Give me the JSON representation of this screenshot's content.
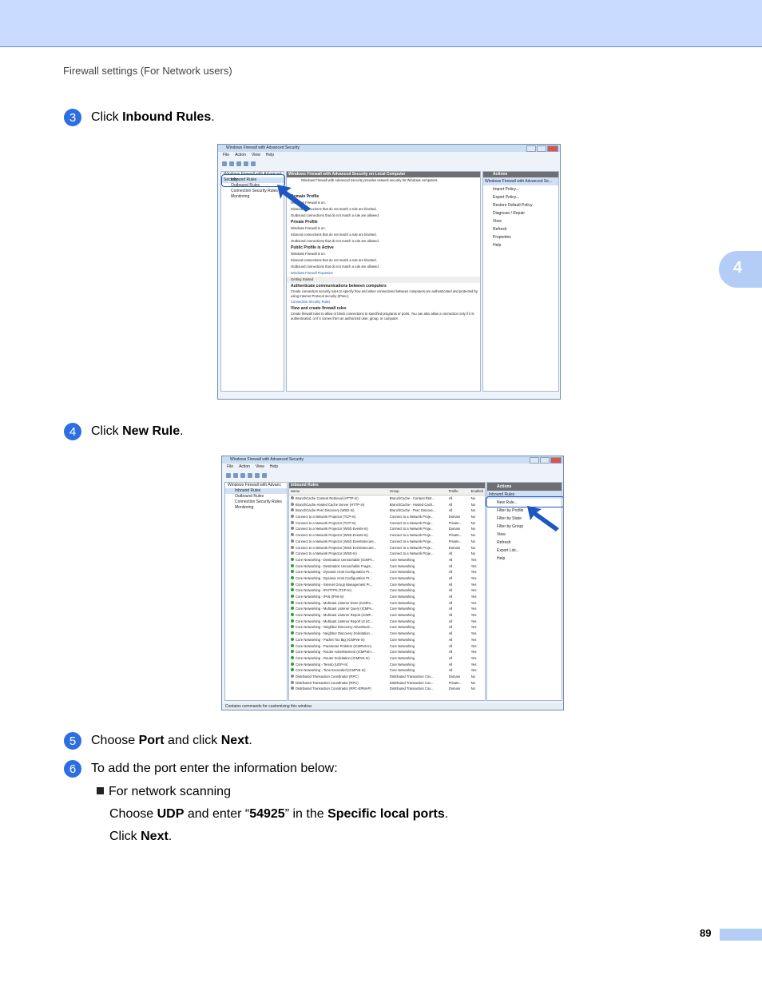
{
  "header": {
    "running_head": "Firewall settings (For Network users)",
    "chapter_tab": "4"
  },
  "steps": [
    {
      "num": "3",
      "prefix": "Click ",
      "bold": "Inbound Rules",
      "suffix": "."
    },
    {
      "num": "4",
      "prefix": "Click ",
      "bold": "New Rule",
      "suffix": "."
    },
    {
      "num": "5",
      "prefix": "Choose ",
      "bold": "Port",
      "middle": " and click ",
      "bold2": "Next",
      "suffix": "."
    },
    {
      "num": "6",
      "text": "To add the port enter the information below:"
    }
  ],
  "bullet": {
    "title": "For network scanning",
    "line1_a": "Choose ",
    "line1_b": "UDP",
    "line1_c": " and enter “",
    "line1_d": "54925",
    "line1_e": "” in the ",
    "line1_f": "Specific local ports",
    "line1_g": ".",
    "line2_a": "Click ",
    "line2_b": "Next",
    "line2_c": "."
  },
  "page_number": "89",
  "shot1": {
    "title": "Windows Firewall with Advanced Security",
    "menu": [
      "File",
      "Action",
      "View",
      "Help"
    ],
    "tree": [
      "Windows Firewall with Advanced Security",
      "Inbound Rules",
      "Outbound Rules",
      "Connection Security Rules",
      "Monitoring"
    ],
    "center_header": "Windows Firewall with Advanced Security on Local Computer",
    "center_intro": "Windows Firewall with Advanced Security provides network security for Windows computers.",
    "domain": "Domain Profile",
    "private": "Private Profile",
    "public": "Public Profile is Active",
    "on": "Windows Firewall is on.",
    "inbound_blocked": "Inbound connections that do not match a rule are blocked.",
    "outbound_allowed": "Outbound connections that do not match a rule are allowed.",
    "props_link": "Windows Firewall Properties",
    "getting_started": "Getting Started",
    "auth_head": "Authenticate communications between computers",
    "auth_text": "Create connection security rules to specify how and when connections between computers are authenticated and protected by using Internet Protocol security (IPsec).",
    "csr_link": "Connection Security Rules",
    "view_head": "View and create firewall rules",
    "view_text": "Create firewall rules to allow or block connections to specified programs or ports. You can also allow a connection only if it is authenticated, or if it comes from an authorized user, group, or computer.",
    "actions_header": "Actions",
    "actions": [
      "Windows Firewall with Advanced Se...",
      "Import Policy...",
      "Export Policy...",
      "Restore Default Policy",
      "Diagnose / Repair",
      "View",
      "Refresh",
      "Properties",
      "Help"
    ]
  },
  "shot2": {
    "title": "Windows Firewall with Advanced Security",
    "menu": [
      "File",
      "Action",
      "View",
      "Help"
    ],
    "tree": [
      "Windows Firewall with Advanc",
      "Inbound Rules",
      "Outbound Rules",
      "Connection Security Rules",
      "Monitoring"
    ],
    "center_header": "Inbound Rules",
    "columns": [
      "Name",
      "Group",
      "Profile",
      "Enabled"
    ],
    "rows": [
      [
        "BranchCache Content Retrieval (HTTP-In)",
        "BranchCache - Content Retr...",
        "All",
        "No"
      ],
      [
        "BranchCache Hosted Cache Server (HTTP-In)",
        "BranchCache - Hosted Cach...",
        "All",
        "No"
      ],
      [
        "BranchCache Peer Discovery (WSD-In)",
        "BranchCache - Peer Discove...",
        "All",
        "No"
      ],
      [
        "Connect to a Network Projector (TCP-In)",
        "Connect to a Network Proje...",
        "Domain",
        "No"
      ],
      [
        "Connect to a Network Projector (TCP-In)",
        "Connect to a Network Proje...",
        "Private...",
        "No"
      ],
      [
        "Connect to a Network Projector (WSD Events-In)",
        "Connect to a Network Proje...",
        "Domain",
        "No"
      ],
      [
        "Connect to a Network Projector (WSD Events-In)",
        "Connect to a Network Proje...",
        "Private...",
        "No"
      ],
      [
        "Connect to a Network Projector (WSD EventsSecure...",
        "Connect to a Network Proje...",
        "Private...",
        "No"
      ],
      [
        "Connect to a Network Projector (WSD EventsSecure...",
        "Connect to a Network Proje...",
        "Domain",
        "No"
      ],
      [
        "Connect to a Network Projector (WSD-In)",
        "Connect to a Network Proje...",
        "All",
        "No"
      ],
      [
        "Core Networking - Destination Unreachable (ICMPv...",
        "Core Networking",
        "All",
        "Yes"
      ],
      [
        "Core Networking - Destination Unreachable Fragm...",
        "Core Networking",
        "All",
        "Yes"
      ],
      [
        "Core Networking - Dynamic Host Configuration Pr...",
        "Core Networking",
        "All",
        "Yes"
      ],
      [
        "Core Networking - Dynamic Host Configuration Pr...",
        "Core Networking",
        "All",
        "Yes"
      ],
      [
        "Core Networking - Internet Group Management Pr...",
        "Core Networking",
        "All",
        "Yes"
      ],
      [
        "Core Networking - IPHTTPS (TCP-In)",
        "Core Networking",
        "All",
        "Yes"
      ],
      [
        "Core Networking - IPv6 (IPv6-In)",
        "Core Networking",
        "All",
        "Yes"
      ],
      [
        "Core Networking - Multicast Listener Done (ICMPv...",
        "Core Networking",
        "All",
        "Yes"
      ],
      [
        "Core Networking - Multicast Listener Query (ICMPv...",
        "Core Networking",
        "All",
        "Yes"
      ],
      [
        "Core Networking - Multicast Listener Report (ICMP...",
        "Core Networking",
        "All",
        "Yes"
      ],
      [
        "Core Networking - Multicast Listener Report v2 (IC...",
        "Core Networking",
        "All",
        "Yes"
      ],
      [
        "Core Networking - Neighbor Discovery Advertisem...",
        "Core Networking",
        "All",
        "Yes"
      ],
      [
        "Core Networking - Neighbor Discovery Solicitation ...",
        "Core Networking",
        "All",
        "Yes"
      ],
      [
        "Core Networking - Packet Too Big (ICMPv6-In)",
        "Core Networking",
        "All",
        "Yes"
      ],
      [
        "Core Networking - Parameter Problem (ICMPv6-In)",
        "Core Networking",
        "All",
        "Yes"
      ],
      [
        "Core Networking - Router Advertisement (ICMPv6-I...",
        "Core Networking",
        "All",
        "Yes"
      ],
      [
        "Core Networking - Router Solicitation (ICMPv6-In)",
        "Core Networking",
        "All",
        "Yes"
      ],
      [
        "Core Networking - Teredo (UDP-In)",
        "Core Networking",
        "All",
        "Yes"
      ],
      [
        "Core Networking - Time Exceeded (ICMPv6-In)",
        "Core Networking",
        "All",
        "Yes"
      ],
      [
        "Distributed Transaction Coordinator (RPC)",
        "Distributed Transaction Coo...",
        "Domain",
        "No"
      ],
      [
        "Distributed Transaction Coordinator (RPC)",
        "Distributed Transaction Coo...",
        "Private...",
        "No"
      ],
      [
        "Distributed Transaction Coordinator (RPC-EPMAP)",
        "Distributed Transaction Coo...",
        "Domain",
        "No"
      ]
    ],
    "actions_header": "Actions",
    "actions": [
      "Inbound Rules",
      "New Rule...",
      "Filter by Profile",
      "Filter by State",
      "Filter by Group",
      "View",
      "Refresh",
      "Export List...",
      "Help"
    ],
    "status": "Contains commands for customizing this window."
  }
}
